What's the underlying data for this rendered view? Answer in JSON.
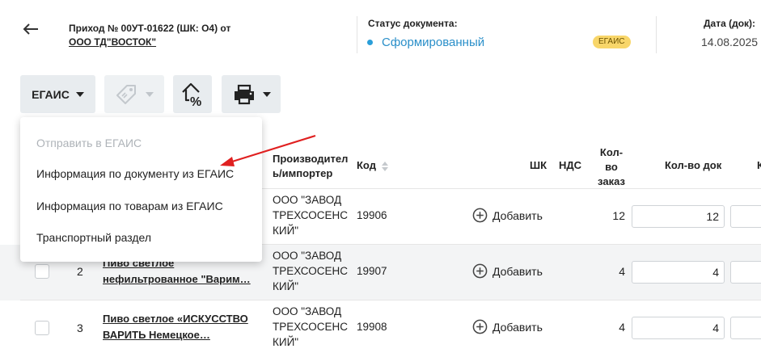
{
  "header": {
    "title": "Приход № 00УТ-01622 (ШК: О4) от",
    "supplier": "ООО ТД\"ВОСТОК\"",
    "status_label": "Статус документа:",
    "status_value": "Сформированный",
    "egais_badge": "ЕГАИС",
    "date_label": "Дата (док):",
    "date_value": "14.08.2025"
  },
  "toolbar": {
    "egais_label": "ЕГАИС",
    "icons": [
      "back-arrow-icon",
      "tag-icon",
      "price-percent-icon",
      "printer-icon"
    ]
  },
  "table": {
    "columns": {
      "maker": "Производитель/импортер",
      "maker_line1": "Производител",
      "maker_line2": "ь/импортер",
      "code": "Код",
      "barcode": "ШК",
      "vat": "НДС",
      "qty_order_1": "Кол-",
      "qty_order_2": "во",
      "qty_order_3": "заказ",
      "qty_doc": "Кол-во док",
      "next_col": "К"
    },
    "add_label": "Добавить",
    "rows": [
      {
        "maker": [
          "ООО \"ЗАВОД",
          "ТРЕХСОСЕНС",
          "КИЙ\""
        ],
        "code": "19906",
        "qty_order": "12",
        "qty_doc": "12"
      },
      {
        "num": "2",
        "name": [
          "Пиво светлое",
          "нефильтрованное \"Варим…"
        ],
        "maker": [
          "ООО \"ЗАВОД",
          "ТРЕХСОСЕНС",
          "КИЙ\""
        ],
        "code": "19907",
        "qty_order": "4",
        "qty_doc": "4"
      },
      {
        "num": "3",
        "name": [
          "Пиво светлое «ИСКУССТВО",
          "ВАРИТЬ Немецкое…"
        ],
        "maker": [
          "ООО \"ЗАВОД",
          "ТРЕХСОСЕНС",
          "КИЙ\""
        ],
        "code": "19908",
        "qty_order": "4",
        "qty_doc": "4"
      }
    ]
  },
  "menu": {
    "items": [
      {
        "label": "Отправить в ЕГАИС",
        "disabled": true
      },
      {
        "label": "Информация по документу из ЕГАИС",
        "disabled": false
      },
      {
        "label": "Информация по товарам из ЕГАИС",
        "disabled": false
      },
      {
        "label": "Транспортный раздел",
        "disabled": false
      }
    ]
  },
  "colors": {
    "accent": "#2a8fc9",
    "badge": "#f8d66a",
    "annotation_arrow": "#e02020",
    "toolbar_button": "#e8ecef"
  }
}
